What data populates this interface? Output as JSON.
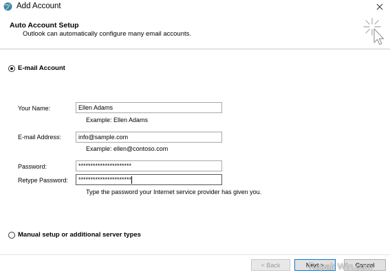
{
  "window": {
    "title": "Add Account",
    "close_glyph": "✕",
    "icon": "outlook-globe-icon"
  },
  "header": {
    "title": "Auto Account Setup",
    "subtitle": "Outlook can automatically configure many email accounts."
  },
  "options": {
    "email_account_label": "E-mail Account",
    "email_account_selected": true,
    "manual_setup_label": "Manual setup or additional server types",
    "manual_setup_selected": false
  },
  "form": {
    "name_label": "Your Name:",
    "name_value": "Ellen Adams",
    "name_hint": "Example: Ellen Adams",
    "email_label": "E-mail Address:",
    "email_value": "info@sample.com",
    "email_hint": "Example: ellen@contoso.com",
    "password_label": "Password:",
    "password_value": "**********************",
    "retype_label": "Retype Password:",
    "retype_value": "**********************",
    "password_hint": "Type the password your Internet service provider has given you."
  },
  "buttons": {
    "back_label": "< Back",
    "next_label": "Next >",
    "cancel_label": "Cancel"
  },
  "watermark": "Repair Win.com"
}
